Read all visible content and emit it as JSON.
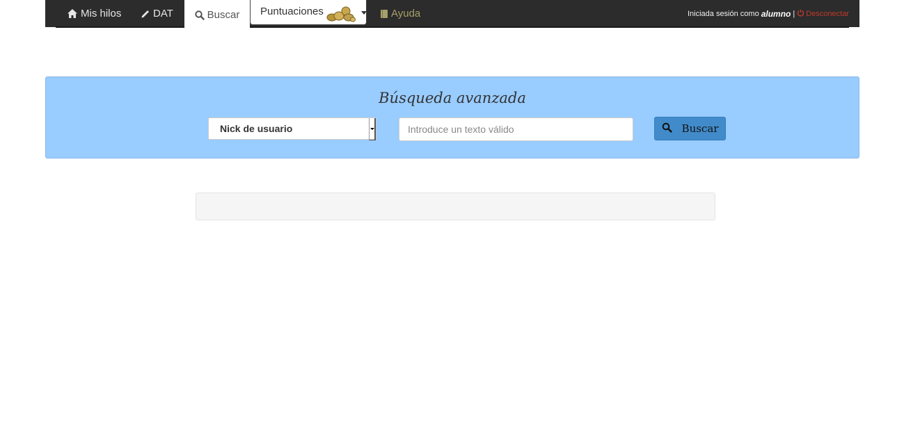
{
  "navbar": {
    "items": [
      {
        "label": "Mis hilos",
        "icon": "home-icon"
      },
      {
        "label": "DAT",
        "icon": "pencil-icon"
      },
      {
        "label": "Buscar",
        "icon": "search-icon",
        "active": true
      },
      {
        "label": "Puntuaciones",
        "icon": "coins-icon",
        "dropdown": true
      },
      {
        "label": "Ayuda",
        "icon": "book-icon"
      }
    ],
    "session": {
      "prefix": "Iniciada sesión como",
      "username": "alumno",
      "separator": "|",
      "logout_label": "Desconectar"
    }
  },
  "search": {
    "title": "Búsqueda avanzada",
    "field_selected": "Nick de usuario",
    "input_value": "",
    "input_placeholder": "Introduce un texto válido",
    "button_label": "Buscar",
    "button_icon": "search-icon"
  },
  "colors": {
    "navbar_bg": "#2c2c2c",
    "panel_bg": "#99ccff",
    "button_bg": "#428bca",
    "ayuda_text": "#a6a06a",
    "logout_text": "#c0392b"
  }
}
